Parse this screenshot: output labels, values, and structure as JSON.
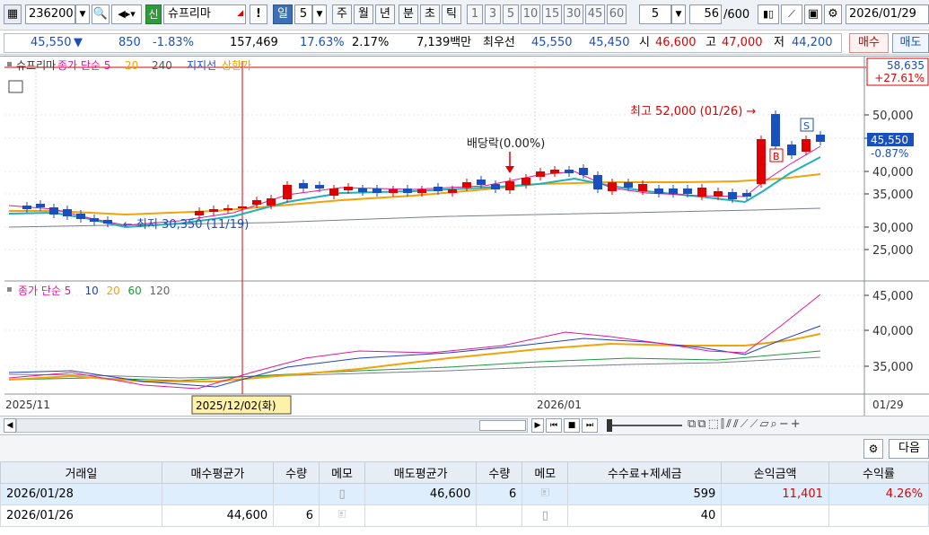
{
  "toolbar": {
    "code": "236200",
    "badge": "신",
    "stock_name": "슈프리마",
    "exclaim": "!",
    "period_day": "일",
    "period_n": "5",
    "period_week": "주",
    "period_month": "월",
    "period_year": "년",
    "period_min": "분",
    "period_sec": "초",
    "period_tick": "틱",
    "intervals": [
      "1",
      "3",
      "5",
      "10",
      "15",
      "30",
      "45",
      "60"
    ],
    "interval_input": "5",
    "count": "56",
    "count_total": "/600",
    "date": "2026/01/29"
  },
  "quote": {
    "price": "45,550",
    "arrow": "▼",
    "change": "850",
    "change_pct": "-1.83%",
    "volume": "157,469",
    "vol_ratio": "17.63%",
    "turnover": "2.17%",
    "amount": "7,139백만",
    "best_label": "최우선",
    "ask": "45,550",
    "bid": "45,450",
    "open_label": "시",
    "open": "46,600",
    "high_label": "고",
    "high": "47,000",
    "low_label": "저",
    "low": "44,200",
    "buy_btn": "매수",
    "sell_btn": "매도"
  },
  "chart": {
    "legend_main": [
      {
        "text": "슈프리마",
        "color": "#333333"
      },
      {
        "text": "종가 단순 5",
        "color": "#e0189a"
      },
      {
        "text": "20",
        "color": "#f0a30a"
      },
      {
        "text": "240",
        "color": "#555555"
      },
      {
        "text": "지지선",
        "color": "#2050c8"
      },
      {
        "text": "상한가",
        "color": "#f0a000"
      }
    ],
    "legend_vol": [
      {
        "text": "종가 단순 5",
        "color": "#e0189a"
      },
      {
        "text": "10",
        "color": "#2040c0"
      },
      {
        "text": "20",
        "color": "#f0a30a"
      },
      {
        "text": "60",
        "color": "#1a9a3a"
      },
      {
        "text": "120",
        "color": "#666666"
      }
    ],
    "upper_y_labels": [
      "50,000",
      "45,000",
      "40,000",
      "35,000",
      "30,000",
      "25,000"
    ],
    "lower_y_labels": [
      "45,000",
      "40,000",
      "35,000"
    ],
    "top_price": "58,635",
    "top_pct": "+27.61%",
    "cur_price": "45,550",
    "cur_pct": "-0.87%",
    "high_annot": "최고 52,000 (01/26) →",
    "low_annot": "← 최저 30,350 (11/19)",
    "div_annot": "배당락(0.00%)",
    "b_marker": "B",
    "s_marker": "S",
    "x_labels": [
      "2025/11",
      "2026/01"
    ],
    "cursor_label": "2025/12/02(화)",
    "right_date": "01/29"
  },
  "table": {
    "headers": [
      "거래일",
      "매수평균가",
      "수량",
      "메모",
      "매도평균가",
      "수량",
      "메모",
      "수수료+제세금",
      "손익금액",
      "수익률"
    ],
    "rows": [
      {
        "date": "2026/01/28",
        "buy_avg": "",
        "buy_qty": "",
        "sell_avg": "46,600",
        "sell_qty": "6",
        "fee": "599",
        "pnl": "11,401",
        "rate": "4.26%"
      },
      {
        "date": "2026/01/26",
        "buy_avg": "44,600",
        "buy_qty": "6",
        "sell_avg": "",
        "sell_qty": "",
        "fee": "40",
        "pnl": "",
        "rate": ""
      }
    ]
  },
  "gear_row": {
    "next_label": "다음"
  },
  "colors": {
    "up": "#e00000",
    "down": "#1a4fc0",
    "accent": "#3d6fb6"
  }
}
